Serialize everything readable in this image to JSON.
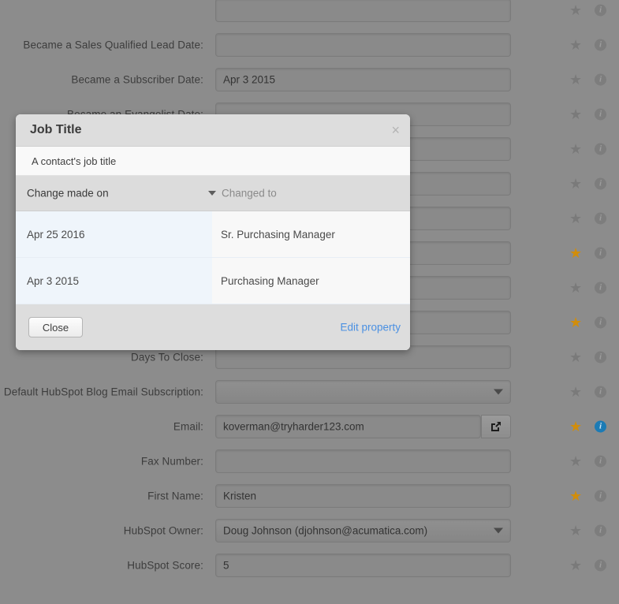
{
  "form": {
    "rows": [
      {
        "label": "",
        "value": "",
        "type": "text",
        "starred": false,
        "info_active": false,
        "partial_top": true
      },
      {
        "label": "Became a Sales Qualified Lead Date:",
        "value": "",
        "type": "text",
        "starred": false,
        "info_active": false
      },
      {
        "label": "Became a Subscriber Date:",
        "value": "Apr 3 2015",
        "type": "text",
        "starred": false,
        "info_active": false
      },
      {
        "label": "Became an Evangelist Date:",
        "value": "",
        "type": "text",
        "starred": false,
        "info_active": false
      },
      {
        "label": "",
        "value": "",
        "type": "text",
        "starred": false,
        "info_active": false
      },
      {
        "label": "",
        "value": "",
        "type": "text",
        "starred": false,
        "info_active": false
      },
      {
        "label": "",
        "value": "",
        "type": "text",
        "starred": false,
        "info_active": false
      },
      {
        "label": "",
        "value": "",
        "type": "text",
        "starred": true,
        "info_active": false
      },
      {
        "label": "",
        "value": "",
        "type": "text",
        "starred": false,
        "info_active": false
      },
      {
        "label": "",
        "value": "",
        "type": "text",
        "starred": true,
        "info_active": false
      },
      {
        "label": "Days To Close:",
        "value": "",
        "type": "text",
        "starred": false,
        "info_active": false
      },
      {
        "label": "Default HubSpot Blog Email Subscription:",
        "value": "",
        "type": "select",
        "starred": false,
        "info_active": false
      },
      {
        "label": "Email:",
        "value": "koverman@tryharder123.com",
        "type": "text-addon",
        "addon_icon": "external-link-icon",
        "starred": true,
        "info_active": true
      },
      {
        "label": "Fax Number:",
        "value": "",
        "type": "text",
        "starred": false,
        "info_active": false
      },
      {
        "label": "First Name:",
        "value": "Kristen",
        "type": "text",
        "starred": true,
        "info_active": false
      },
      {
        "label": "HubSpot Owner:",
        "value": "Doug Johnson (djohnson@acumatica.com)",
        "type": "select",
        "starred": false,
        "info_active": false
      },
      {
        "label": "HubSpot Score:",
        "value": "5",
        "type": "text",
        "starred": false,
        "info_active": false
      }
    ],
    "star_icon": "★",
    "info_icon": "i"
  },
  "modal": {
    "title": "Job Title",
    "close_icon": "×",
    "description": "A contact's job title",
    "columns": {
      "date": "Change made on",
      "value": "Changed to"
    },
    "sort_icon": "caret-down-icon",
    "history": [
      {
        "date": "Apr 25 2016",
        "value": "Sr. Purchasing Manager"
      },
      {
        "date": "Apr 3 2015",
        "value": "Purchasing Manager"
      }
    ],
    "close_button": "Close",
    "edit_link": "Edit property"
  },
  "colors": {
    "backdrop": "#8c8c8c",
    "star_active": "#d18d0b",
    "info_active": "#1c7bb5",
    "link": "#4a90e2",
    "row_date_bg": "#eff5fb"
  }
}
